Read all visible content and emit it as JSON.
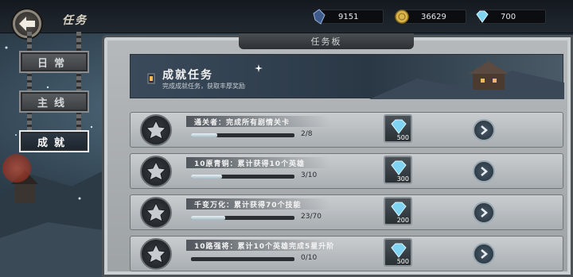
{
  "header": {
    "title": "任务"
  },
  "currencies": [
    {
      "icon": "dark-crystal-icon",
      "value": "9151"
    },
    {
      "icon": "gold-coin-icon",
      "value": "36629"
    },
    {
      "icon": "diamond-icon",
      "value": "700"
    }
  ],
  "tabs": [
    {
      "label": "日常",
      "active": false
    },
    {
      "label": "主线",
      "active": false
    },
    {
      "label": "成就",
      "active": true
    }
  ],
  "board": {
    "title": "任务板",
    "banner_title": "成就任务",
    "banner_subtitle": "完成成就任务，获取丰厚奖励"
  },
  "tasks": [
    {
      "desc": "通关者：完成所有剧情关卡",
      "progress_text": "2/8",
      "progress": 0.25,
      "reward": "500"
    },
    {
      "desc": "10原青铜：累计获得10个英雄",
      "progress_text": "3/10",
      "progress": 0.3,
      "reward": "300"
    },
    {
      "desc": "千变万化：累计获得70个技能",
      "progress_text": "23/70",
      "progress": 0.33,
      "reward": "200"
    },
    {
      "desc": "10路强将：累计10个英雄完成5星升阶",
      "progress_text": "0/10",
      "progress": 0.0,
      "reward": "500"
    }
  ],
  "colors": {
    "board": "#b5b9bb",
    "banner": "#2a3846",
    "diamond": "#7fd3f2"
  }
}
